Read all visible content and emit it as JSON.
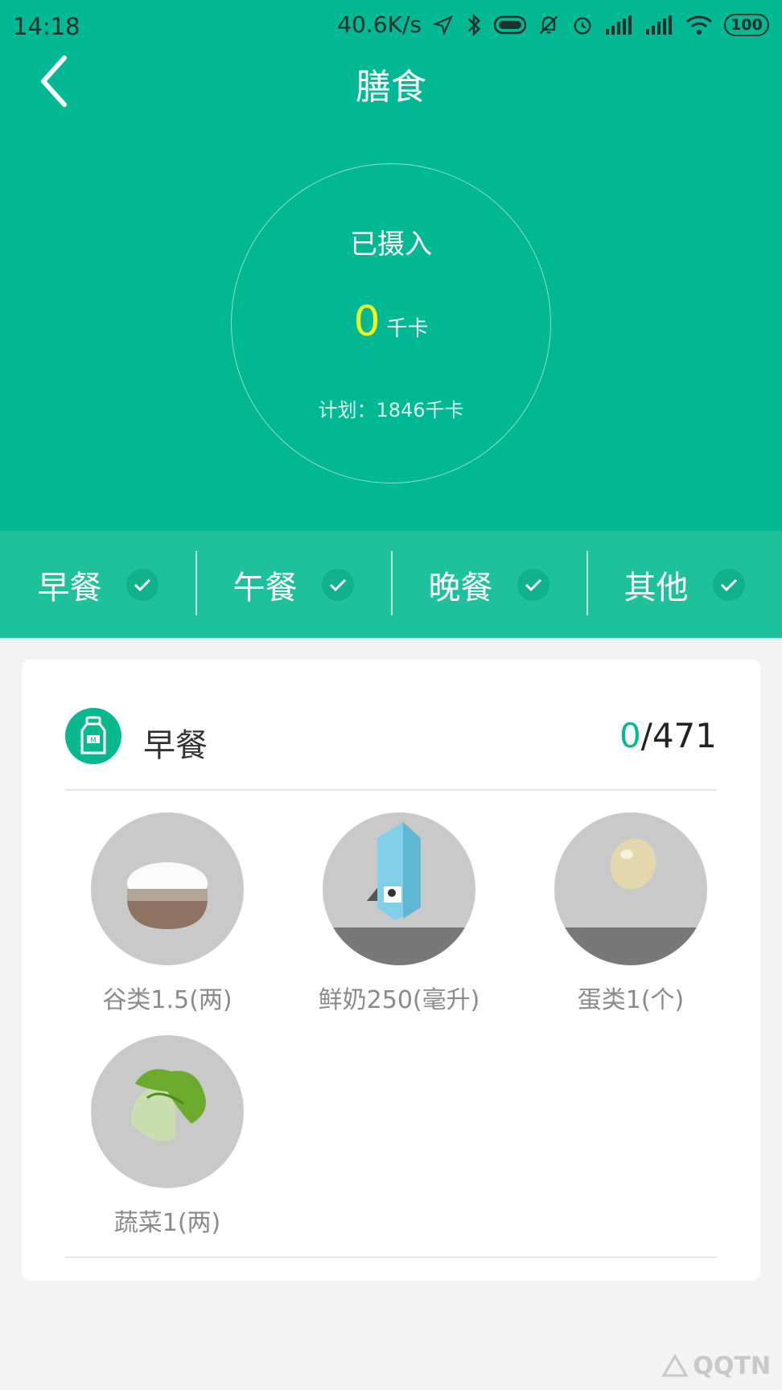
{
  "status": {
    "time": "14:18",
    "speed": "40.6K/s",
    "battery": "100"
  },
  "header": {
    "title": "膳食",
    "back_icon": "chevron-left-icon"
  },
  "summary": {
    "label": "已摄入",
    "intake_value": "0",
    "intake_unit": "千卡",
    "plan_text": "计划：1846千卡"
  },
  "tabs": [
    {
      "label": "早餐",
      "icon": "check-icon"
    },
    {
      "label": "午餐",
      "icon": "check-icon"
    },
    {
      "label": "晚餐",
      "icon": "check-icon"
    },
    {
      "label": "其他",
      "icon": "check-icon"
    }
  ],
  "meal": {
    "name": "早餐",
    "icon": "milk-bottle-icon",
    "current": "0",
    "target": "/471",
    "foods": [
      {
        "label": "谷类1.5(两)",
        "icon": "rice-bowl-icon"
      },
      {
        "label": "鲜奶250(毫升)",
        "icon": "milk-carton-icon"
      },
      {
        "label": "蛋类1(个)",
        "icon": "egg-icon"
      },
      {
        "label": "蔬菜1(两)",
        "icon": "cabbage-icon"
      }
    ]
  },
  "watermark": "QQTN",
  "colors": {
    "primary": "#00b894",
    "tab_bar": "#1fc19c",
    "accent_value": "#f4f21c",
    "count_highlight": "#0ab88f"
  }
}
